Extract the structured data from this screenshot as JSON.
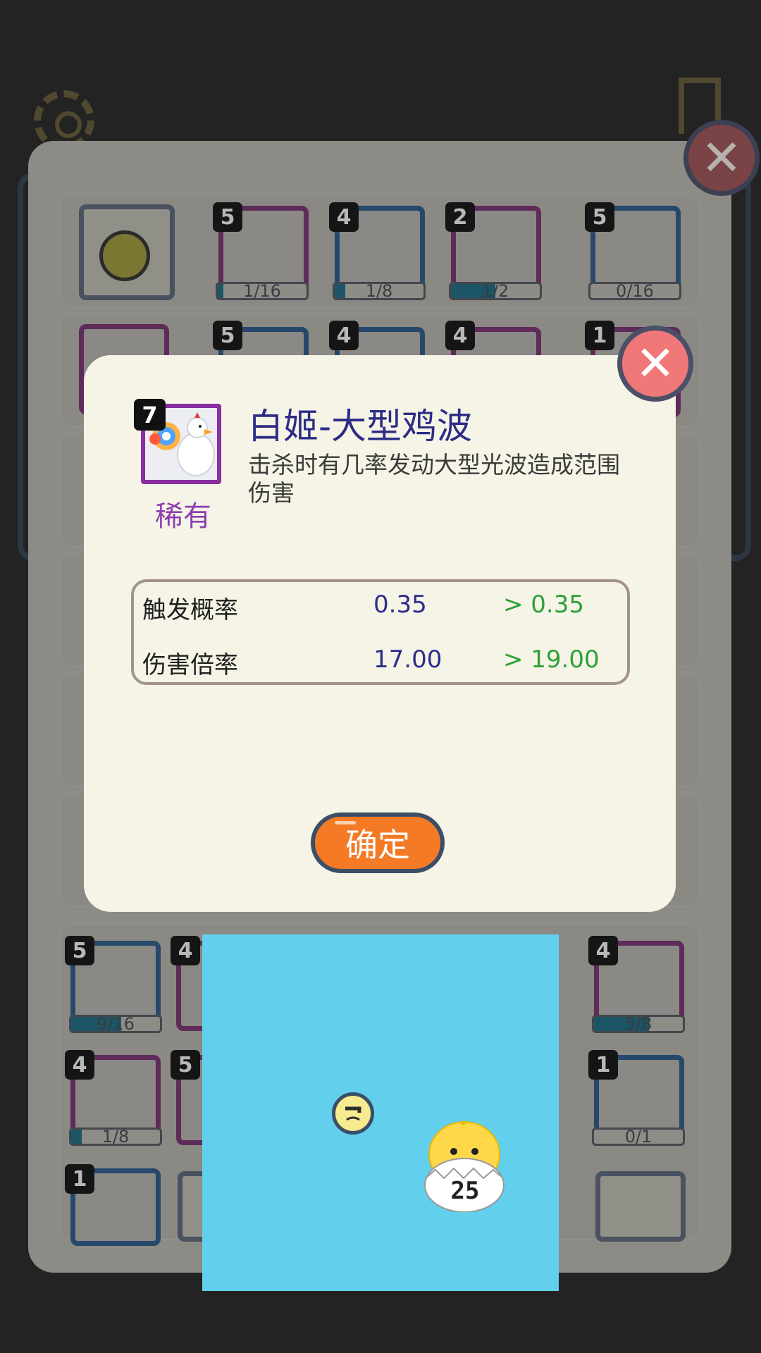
{
  "background_rows": {
    "row1": [
      {
        "level": "5",
        "progress": "1/16",
        "fill": 0.06
      },
      {
        "level": "4",
        "progress": "1/8",
        "fill": 0.12
      },
      {
        "level": "2",
        "progress": "1/2",
        "fill": 0.5
      },
      {
        "level": "5",
        "progress": "0/16",
        "fill": 0
      }
    ],
    "row2_levels": [
      "5",
      "4",
      "4",
      "1"
    ],
    "bottom_row1": [
      {
        "level": "5",
        "progress": "9/16",
        "fill": 0.56
      },
      {
        "level": "4"
      },
      {
        "level": "4",
        "progress": "5/8",
        "fill": 0.62
      }
    ],
    "bottom_row2": [
      {
        "level": "4",
        "progress": "1/8",
        "fill": 0.12
      },
      {
        "level": "5"
      },
      {
        "level": "1",
        "progress": "0/1",
        "fill": 0
      }
    ],
    "bottom_row3": [
      {
        "level": "1"
      }
    ]
  },
  "modal": {
    "skill_level": "7",
    "rarity": "稀有",
    "title": "白姬-大型鸡波",
    "description": "击杀时有几率发动大型光波造成范围伤害",
    "stats": [
      {
        "label": "触发概率",
        "current": "0.35",
        "next": "> 0.35"
      },
      {
        "label": "伤害倍率",
        "current": "17.00",
        "next": "> 19.00"
      }
    ],
    "confirm_label": "确定",
    "close_glyph": "✕"
  },
  "panel_close_glyph": "✕",
  "ad": {
    "egg_number": "25"
  },
  "colors": {
    "modal_bg": "#f5f4e6",
    "title": "#2c2c86",
    "rarity": "#8e3fb0",
    "next_value": "#2ea137",
    "confirm": "#f47a26",
    "ad_bg": "#62cfec"
  }
}
